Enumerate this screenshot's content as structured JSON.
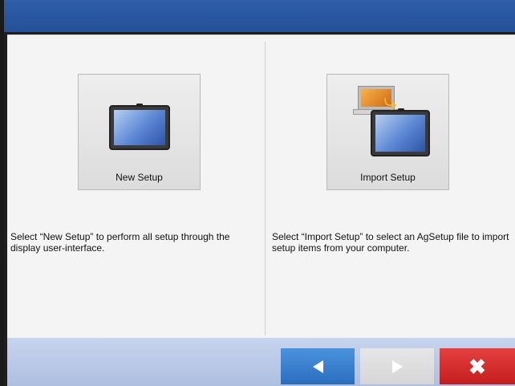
{
  "new_setup": {
    "label": "New Setup",
    "description": "Select “New Setup” to perform all setup through the display user-interface.",
    "icon": "tablet-display-icon"
  },
  "import_setup": {
    "label": "Import Setup",
    "description": "Select “Import Setup” to select an AgSetup file to import setup items from your computer.",
    "icon": "computer-to-display-import-icon"
  },
  "nav": {
    "back_icon": "left-arrow-icon",
    "next_icon": "right-arrow-icon",
    "cancel_icon": "close-icon",
    "cancel_glyph": "✖"
  },
  "colors": {
    "title_bar": "#25509a",
    "back_button": "#2a6fbe",
    "cancel_button": "#c41d1d",
    "next_button_disabled": "#d6d6d6"
  }
}
